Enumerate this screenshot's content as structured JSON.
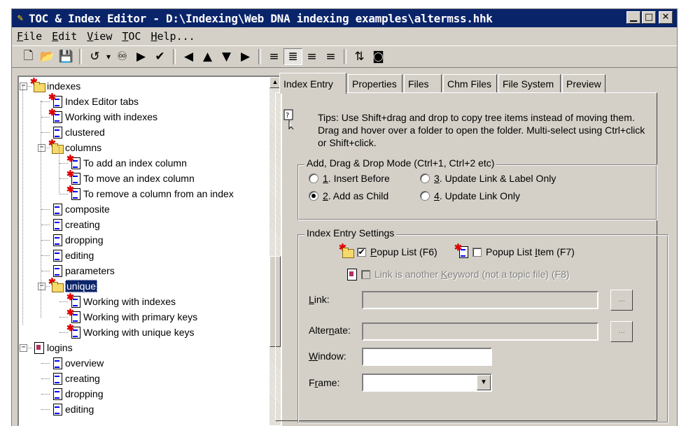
{
  "window": {
    "title": "TOC & Index Editor - D:\\Indexing\\Web DNA indexing examples\\altermss.hhk",
    "buttons": {
      "minimize": "▁",
      "maximize": "□",
      "close": "✕"
    }
  },
  "menu": [
    {
      "label": "File",
      "key": "F",
      "rest": "ile"
    },
    {
      "label": "Edit",
      "key": "E",
      "rest": "dit"
    },
    {
      "label": "View",
      "key": "V",
      "rest": "iew"
    },
    {
      "label": "TOC",
      "key": "T",
      "rest": "OC"
    },
    {
      "label": "Help...",
      "key": "H",
      "rest": "elp..."
    }
  ],
  "toolbar": [
    {
      "name": "new-icon",
      "glyph": "🗋"
    },
    {
      "name": "open-icon",
      "glyph": "📂"
    },
    {
      "name": "save-icon",
      "glyph": "💾"
    },
    {
      "sep": true
    },
    {
      "name": "undo-icon",
      "glyph": "↺"
    },
    {
      "name": "undo-dropdown-icon",
      "glyph": "▾"
    },
    {
      "name": "find-icon",
      "glyph": "♾"
    },
    {
      "name": "run-icon",
      "glyph": "▶"
    },
    {
      "name": "check-links-icon",
      "glyph": "✔"
    },
    {
      "sep": true
    },
    {
      "name": "move-left-icon",
      "glyph": "◀"
    },
    {
      "name": "move-up-icon",
      "glyph": "▲"
    },
    {
      "name": "move-down-icon",
      "glyph": "▼"
    },
    {
      "name": "move-right-icon",
      "glyph": "▶"
    },
    {
      "sep": true
    },
    {
      "name": "insert-before-icon",
      "glyph": "≡"
    },
    {
      "name": "add-as-child-icon",
      "glyph": "≣",
      "selected": true
    },
    {
      "name": "update-link-label-icon",
      "glyph": "≡"
    },
    {
      "name": "update-link-icon",
      "glyph": "≡"
    },
    {
      "sep": true
    },
    {
      "name": "sort-icon",
      "glyph": "⇅"
    },
    {
      "name": "properties-icon",
      "glyph": "◙"
    }
  ],
  "tree": [
    {
      "label": "indexes",
      "icon": "folder",
      "star": true,
      "level": 0,
      "exp": "-"
    },
    {
      "label": "Index Editor tabs",
      "icon": "page",
      "star": true,
      "level": 1
    },
    {
      "label": "Working with indexes",
      "icon": "page",
      "star": true,
      "level": 1
    },
    {
      "label": "clustered",
      "icon": "page",
      "level": 1
    },
    {
      "label": "columns",
      "icon": "folder",
      "star": true,
      "level": 1,
      "exp": "-"
    },
    {
      "label": "To add an index column",
      "icon": "page",
      "star": true,
      "level": 2
    },
    {
      "label": "To move an index column",
      "icon": "page",
      "star": true,
      "level": 2
    },
    {
      "label": "To remove a column from an index",
      "icon": "page",
      "star": true,
      "level": 2
    },
    {
      "label": "composite",
      "icon": "page",
      "level": 1
    },
    {
      "label": "creating",
      "icon": "page",
      "level": 1
    },
    {
      "label": "dropping",
      "icon": "page",
      "level": 1
    },
    {
      "label": "editing",
      "icon": "page",
      "level": 1
    },
    {
      "label": "parameters",
      "icon": "page",
      "level": 1
    },
    {
      "label": "unique",
      "icon": "folder",
      "star": true,
      "level": 1,
      "exp": "-",
      "selected": true
    },
    {
      "label": "Working with indexes",
      "icon": "page",
      "star": true,
      "level": 2
    },
    {
      "label": "Working with primary keys",
      "icon": "page",
      "star": true,
      "level": 2
    },
    {
      "label": "Working with unique keys",
      "icon": "page",
      "star": true,
      "level": 2
    },
    {
      "label": "logins",
      "icon": "book",
      "level": 0,
      "exp": "-"
    },
    {
      "label": "overview",
      "icon": "page",
      "level": 1
    },
    {
      "label": "creating",
      "icon": "page",
      "level": 1
    },
    {
      "label": "dropping",
      "icon": "page",
      "level": 1
    },
    {
      "label": "editing",
      "icon": "page",
      "level": 1
    }
  ],
  "tabs": [
    "Index Entry",
    "Properties",
    "Files",
    "Chm Files",
    "File System",
    "Preview"
  ],
  "active_tab": "Index Entry",
  "tips": {
    "line1": "Tips:  Use Shift+drag and drop to copy tree items instead of moving them.",
    "line2": "Drag and hover over a folder to open the folder. Multi-select using Ctrl+click",
    "line3": "or Shift+click."
  },
  "mode_group": {
    "label": "Add, Drag & Drop Mode (Ctrl+1, Ctrl+2 etc)",
    "options": [
      {
        "key": "1",
        "text": ". Insert Before",
        "checked": false
      },
      {
        "key": "2",
        "text": ". Add as Child",
        "checked": true
      },
      {
        "key": "3",
        "text": ". Update Link & Label Only",
        "checked": false
      },
      {
        "key": "4",
        "text": ". Update Link Only",
        "checked": false
      }
    ]
  },
  "settings_group": {
    "label": "Index Entry Settings",
    "popup_list": {
      "key": "P",
      "rest": "opup List (F6)",
      "checked": true
    },
    "popup_list_item": {
      "pre": "Popup List ",
      "key": "I",
      "rest": "tem (F7)",
      "checked": false
    },
    "link_keyword": {
      "pre": "Link is another ",
      "key": "K",
      "rest": "eyword (not a topic file) (F8)",
      "checked": false,
      "disabled": true
    },
    "link_label": {
      "key": "L",
      "rest": "ink:"
    },
    "alternate_label": {
      "pre": "Alter",
      "key": "n",
      "rest": "ate:"
    },
    "window_label": {
      "key": "W",
      "rest": "indow:"
    },
    "frame_label": {
      "pre": "F",
      "key": "r",
      "rest": "ame:"
    },
    "link_value": "",
    "alternate_value": "",
    "window_value": "",
    "frame_value": "",
    "browse": "..."
  }
}
